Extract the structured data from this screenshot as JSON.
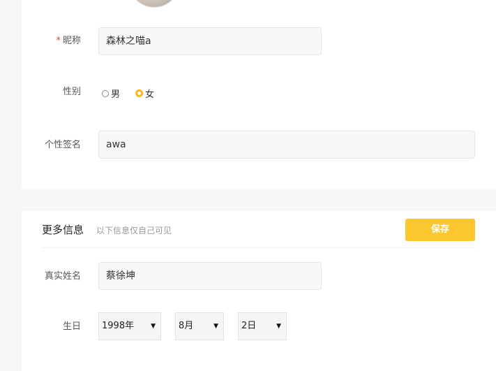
{
  "profile": {
    "nickname_label": "昵称",
    "nickname_required_mark": "*",
    "nickname_value": "森林之喵a",
    "gender_label": "性别",
    "gender_options": [
      "男",
      "女"
    ],
    "gender_selected": "女",
    "signature_label": "个性签名",
    "signature_value": "awa"
  },
  "more_info": {
    "title": "更多信息",
    "subtitle": "以下信息仅自己可见",
    "save_label": "保存",
    "realname_label": "真实姓名",
    "realname_value": "蔡徐坤",
    "birthday_label": "生日",
    "birthday_year": "1998年",
    "birthday_month": "8月",
    "birthday_day": "2日"
  },
  "colors": {
    "accent": "#fcc72e",
    "required": "#e4393c",
    "background": "#f7f7f7"
  },
  "icons": {
    "dropdown": "▼"
  }
}
